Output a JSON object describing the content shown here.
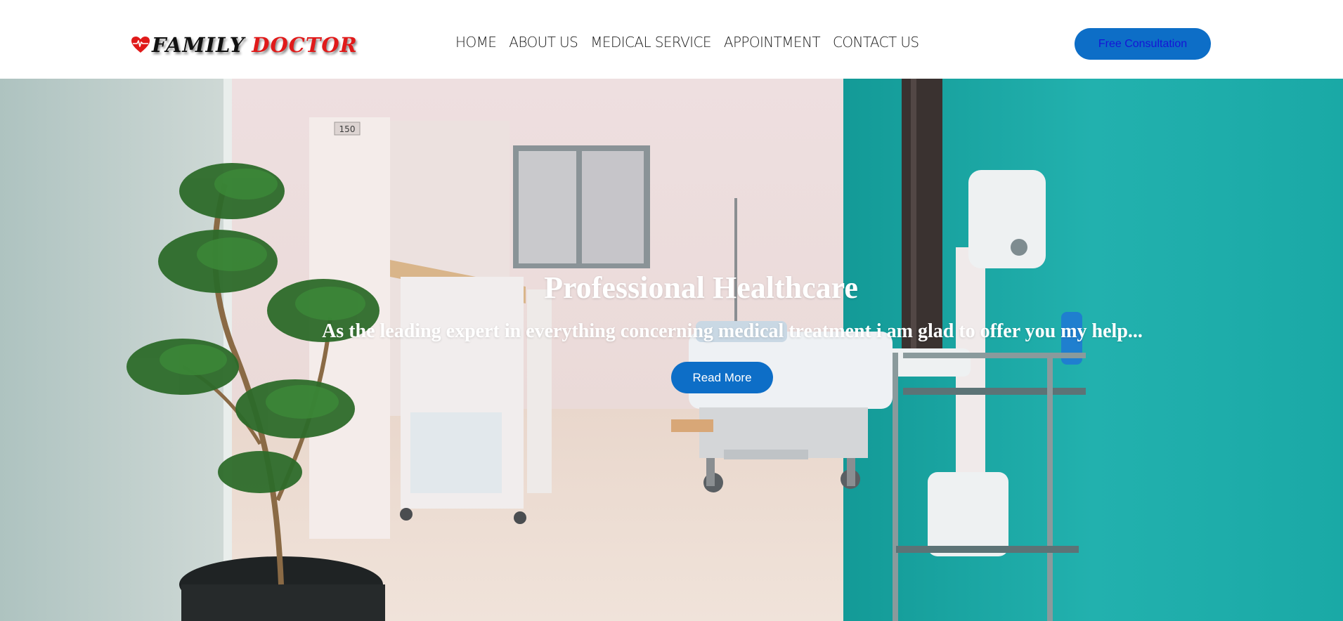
{
  "header": {
    "logo": {
      "family": "FAMILY",
      "doctor": "DOCTOR"
    },
    "nav": [
      {
        "label": "HOME"
      },
      {
        "label": "ABOUT US"
      },
      {
        "label": "MEDICAL SERVICE"
      },
      {
        "label": "APPOINTMENT"
      },
      {
        "label": "CONTACT US"
      }
    ],
    "cta_label": "Free Consultation"
  },
  "hero": {
    "title": "Professional Healthcare",
    "subtitle": "As the leading expert in everything concerning medical treatment i am glad to offer you my help...",
    "button_label": "Read More",
    "room_number": "150"
  },
  "colors": {
    "accent_blue": "#0d6ec7",
    "logo_red": "#e01a1a",
    "wall_teal": "#1aa9a6",
    "cta_text": "#1515d6"
  }
}
